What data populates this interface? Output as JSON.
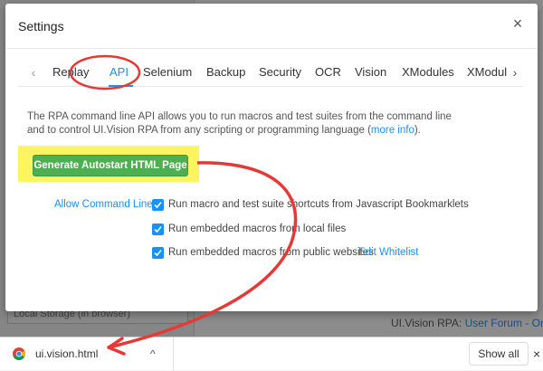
{
  "background": {
    "storage_text": "Local Storage (in browser)",
    "footer_prefix": "UI.Vision RPA:",
    "footer_link": "User Forum - Onli"
  },
  "dialog": {
    "title": "Settings",
    "close_glyph": "×",
    "tabs": [
      "Replay",
      "API",
      "Selenium",
      "Backup",
      "Security",
      "OCR",
      "Vision",
      "XModules",
      "XModule"
    ],
    "active_tab": "API",
    "tab_prev_glyph": "‹",
    "tab_next_glyph": "›",
    "description_text": "The RPA command line API allows you to run macros and test suites from the command line and to control UI.Vision RPA from any scripting or programming language (",
    "description_link": "more info",
    "description_suffix": ").",
    "generate_button": "Generate Autostart HTML Page",
    "allow_label": "Allow Command Line :",
    "options": [
      {
        "label": "Run macro and test suite shortcuts from Javascript Bookmarklets",
        "checked": true
      },
      {
        "label": "Run embedded macros from local files",
        "checked": true
      },
      {
        "label": "Run embedded macros from public websites",
        "checked": true
      }
    ],
    "whitelist_link": "Edit Whitelist"
  },
  "download_bar": {
    "file_name": "ui.vision.html",
    "chevron_glyph": "^",
    "show_all": "Show all",
    "close_glyph": "×"
  },
  "colors": {
    "accent": "#1890ff",
    "button_green": "#4caf50",
    "highlight_yellow": "#fcf55f",
    "annotation_red": "#e53935"
  }
}
